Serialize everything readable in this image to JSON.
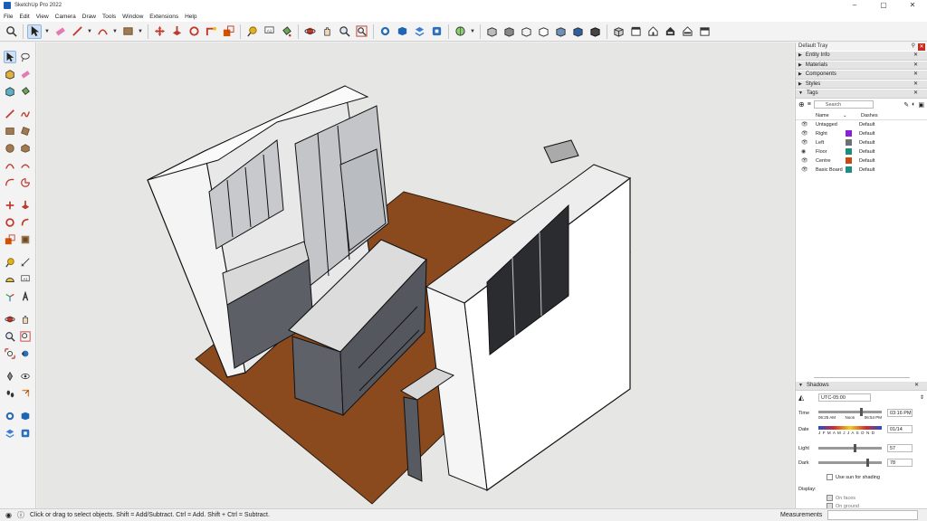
{
  "window": {
    "title": "SketchUp Pro 2022",
    "controls": [
      "–",
      "▢",
      "✕"
    ]
  },
  "menu": [
    "File",
    "Edit",
    "View",
    "Camera",
    "Draw",
    "Tools",
    "Window",
    "Extensions",
    "Help"
  ],
  "tray": {
    "title": "Default Tray",
    "panels": [
      "Entity Info",
      "Materials",
      "Components",
      "Styles"
    ],
    "tags": {
      "header": "Tags",
      "search_placeholder": "Search",
      "col_name": "Name",
      "col_dashes": "Dashes",
      "rows": [
        {
          "name": "Untagged",
          "color": "#ffffff",
          "dashes": "Default",
          "active": false
        },
        {
          "name": "Right",
          "color": "#8a1fd6",
          "dashes": "Default",
          "active": false
        },
        {
          "name": "Left",
          "color": "#6f6f78",
          "dashes": "Default",
          "active": false
        },
        {
          "name": "Floor",
          "color": "#1f8c7a",
          "dashes": "Default",
          "active": true
        },
        {
          "name": "Centre",
          "color": "#c44a12",
          "dashes": "Default",
          "active": false
        },
        {
          "name": "Basic Board",
          "color": "#1d8c82",
          "dashes": "Default",
          "active": false
        }
      ]
    },
    "shadows": {
      "header": "Shadows",
      "timezone": "UTC-05:00",
      "time_label": "Time",
      "time_start": "06:25 AM",
      "time_noon": "Noon",
      "time_end": "06:54 PM",
      "time_value": "03:16 PM",
      "date_label": "Date",
      "months": "J F M A M J J A S O N D",
      "date_value": "01/14",
      "light_label": "Light",
      "light_value": "57",
      "dark_label": "Dark",
      "dark_value": "78",
      "use_sun_label": "Use sun for shading",
      "display_label": "Display:",
      "on_faces_label": "On faces",
      "on_ground_label": "On ground"
    }
  },
  "status": {
    "hint": "Click or drag to select objects. Shift = Add/Subtract. Ctrl = Add. Shift + Ctrl = Subtract.",
    "measurements_label": "Measurements"
  }
}
